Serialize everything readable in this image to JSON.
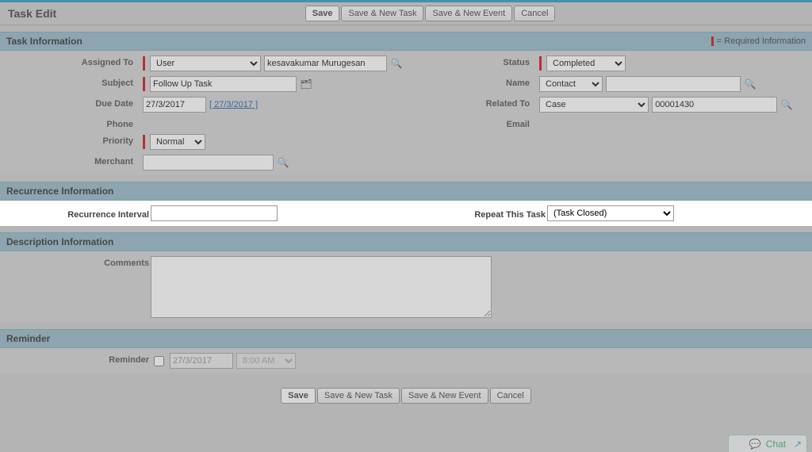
{
  "header": {
    "title": "Task Edit",
    "buttons": {
      "save": "Save",
      "saveNewTask": "Save & New Task",
      "saveNewEvent": "Save & New Event",
      "cancel": "Cancel"
    }
  },
  "sections": {
    "taskInfo": {
      "title": "Task Information",
      "requiredHint": "= Required Information",
      "labels": {
        "assignedTo": "Assigned To",
        "subject": "Subject",
        "dueDate": "Due Date",
        "phone": "Phone",
        "priority": "Priority",
        "merchant": "Merchant",
        "status": "Status",
        "name": "Name",
        "relatedTo": "Related To",
        "email": "Email"
      },
      "values": {
        "assignedToType": "User",
        "assignedToName": "kesavakumar Murugesan",
        "subject": "Follow Up Task",
        "dueDate": "27/3/2017",
        "dueDateLink": "[ 27/3/2017 ]",
        "priority": "Normal",
        "merchant": "",
        "status": "Completed",
        "nameType": "Contact",
        "nameValue": "",
        "relatedToType": "Case",
        "relatedToValue": "00001430"
      }
    },
    "recurrence": {
      "title": "Recurrence Information",
      "labels": {
        "interval": "Recurrence Interval",
        "repeat": "Repeat This Task"
      },
      "values": {
        "interval": "",
        "repeat": "(Task Closed)"
      }
    },
    "description": {
      "title": "Description Information",
      "labels": {
        "comments": "Comments"
      },
      "values": {
        "comments": ""
      }
    },
    "reminder": {
      "title": "Reminder",
      "labels": {
        "reminder": "Reminder"
      },
      "values": {
        "date": "27/3/2017",
        "time": "8:00 AM"
      }
    }
  },
  "footer": {
    "buttons": {
      "save": "Save",
      "saveNewTask": "Save & New Task",
      "saveNewEvent": "Save & New Event",
      "cancel": "Cancel"
    }
  },
  "chat": {
    "label": "Chat"
  },
  "icons": {
    "lookup": "🔍",
    "subjectPicker": "🗂",
    "expand": "↗"
  }
}
